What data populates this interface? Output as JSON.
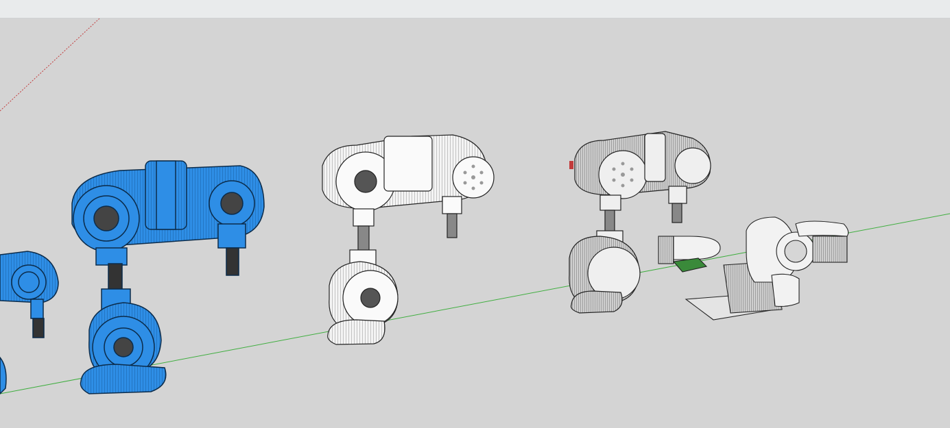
{
  "window": {
    "title": ""
  },
  "viewport": {
    "background": "#d4d4d4",
    "axis_colors": {
      "green": "#3fae3f",
      "red": "#c23c3c"
    },
    "models": [
      {
        "name": "robot-arm-blue",
        "color": "#2e8ee6",
        "icon": "robot-arm-icon"
      },
      {
        "name": "robot-arm-white",
        "color": "#ffffff",
        "icon": "robot-arm-icon"
      },
      {
        "name": "robot-arm-white-shaded",
        "color": "#f2f2f2",
        "icon": "robot-arm-icon"
      },
      {
        "name": "exploded-parts",
        "color": "#f2f2f2",
        "icon": "parts-icon"
      }
    ]
  }
}
